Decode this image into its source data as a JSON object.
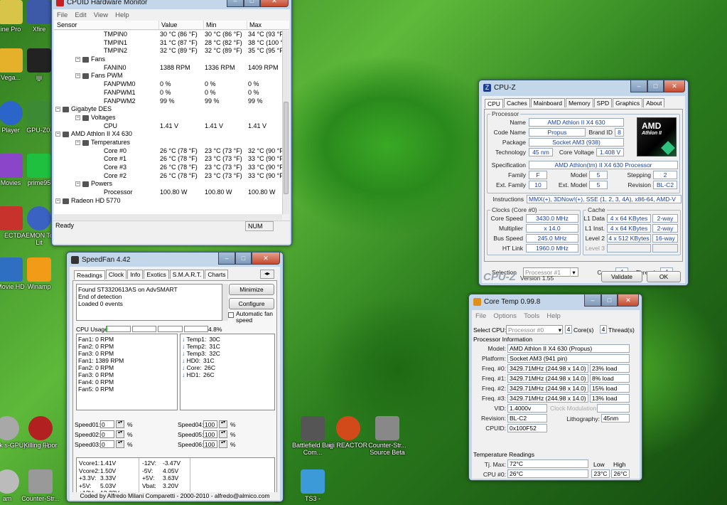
{
  "desktop": {
    "icons": [
      {
        "label": "ine Pro",
        "color": "#d9c44a"
      },
      {
        "label": "Xfire",
        "color": "#3c5aa8"
      },
      {
        "label": "Vega...",
        "color": "#e6b12a"
      },
      {
        "label": "ijji",
        "color": "#222"
      },
      {
        "label": "Player",
        "color": "#2b65c9"
      },
      {
        "label": "GPU-Z0.",
        "color": "#3d8a35"
      },
      {
        "label": "Movies",
        "color": "#8a45c8"
      },
      {
        "label": "prime95",
        "color": "#1fbf3f"
      },
      {
        "label": "ECT",
        "color": "#c8322c"
      },
      {
        "label": "DAEMON Tools Lit",
        "color": "#3a62c2"
      },
      {
        "label": "Movie HD",
        "color": "#2f6fc2"
      },
      {
        "label": "Winamp",
        "color": "#f29b16"
      },
      {
        "label": "Mark s-GPU)",
        "color": "#a8a8a8"
      },
      {
        "label": "Killing Floor",
        "color": "#b32020"
      },
      {
        "label": "H",
        "color": "#444"
      },
      {
        "label": "Battlefield Bad Com...",
        "color": "#555"
      },
      {
        "label": "ijji REACTOR",
        "color": "#d24a1a"
      },
      {
        "label": "Counter-Str... Source Beta",
        "color": "#888"
      },
      {
        "label": "am",
        "color": "#bbb"
      },
      {
        "label": "Counter-Str...",
        "color": "#999"
      },
      {
        "label": "TS3 -",
        "color": "#3c9ad8"
      },
      {
        "label": "ft",
        "color": "#777"
      }
    ]
  },
  "hwmonitor": {
    "title": "CPUID Hardware Monitor",
    "menu": [
      "File",
      "Edit",
      "View",
      "Help"
    ],
    "columns": [
      "Sensor",
      "Value",
      "Min",
      "Max"
    ],
    "rows": [
      {
        "indent": 70,
        "name": "TMPIN0",
        "v": "30 °C  (86 °F)",
        "mn": "30 °C  (86 °F)",
        "mx": "34 °C  (93 °F"
      },
      {
        "indent": 70,
        "name": "TMPIN1",
        "v": "31 °C  (87 °F)",
        "mn": "28 °C  (82 °F)",
        "mx": "38 °C  (100 °"
      },
      {
        "indent": 70,
        "name": "TMPIN2",
        "v": "32 °C  (89 °F)",
        "mn": "32 °C  (89 °F)",
        "mx": "35 °C  (95 °F"
      },
      {
        "indent": 44,
        "name": "Fans",
        "v": "",
        "mn": "",
        "mx": ""
      },
      {
        "indent": 70,
        "name": "FANIN0",
        "v": "1388 RPM",
        "mn": "1336 RPM",
        "mx": "1409 RPM"
      },
      {
        "indent": 44,
        "name": "Fans PWM",
        "v": "",
        "mn": "",
        "mx": ""
      },
      {
        "indent": 70,
        "name": "FANPWM0",
        "v": "0 %",
        "mn": "0 %",
        "mx": "0 %"
      },
      {
        "indent": 70,
        "name": "FANPWM1",
        "v": "0 %",
        "mn": "0 %",
        "mx": "0 %"
      },
      {
        "indent": 70,
        "name": "FANPWM2",
        "v": "99 %",
        "mn": "99 %",
        "mx": "99 %"
      },
      {
        "indent": 16,
        "name": "Gigabyte DES",
        "v": "",
        "mn": "",
        "mx": ""
      },
      {
        "indent": 44,
        "name": "Voltages",
        "v": "",
        "mn": "",
        "mx": ""
      },
      {
        "indent": 70,
        "name": "CPU",
        "v": "1.41 V",
        "mn": "1.41 V",
        "mx": "1.41 V"
      },
      {
        "indent": 16,
        "name": "AMD Athlon II X4 630",
        "v": "",
        "mn": "",
        "mx": ""
      },
      {
        "indent": 44,
        "name": "Temperatures",
        "v": "",
        "mn": "",
        "mx": ""
      },
      {
        "indent": 70,
        "name": "Core #0",
        "v": "26 °C  (78 °F)",
        "mn": "23 °C  (73 °F)",
        "mx": "32 °C  (90 °F"
      },
      {
        "indent": 70,
        "name": "Core #1",
        "v": "26 °C  (78 °F)",
        "mn": "23 °C  (73 °F)",
        "mx": "33 °C  (90 °F"
      },
      {
        "indent": 70,
        "name": "Core #3",
        "v": "26 °C  (78 °F)",
        "mn": "23 °C  (73 °F)",
        "mx": "33 °C  (90 °F"
      },
      {
        "indent": 70,
        "name": "Core #2",
        "v": "26 °C  (78 °F)",
        "mn": "23 °C  (73 °F)",
        "mx": "33 °C  (90 °F"
      },
      {
        "indent": 44,
        "name": "Powers",
        "v": "",
        "mn": "",
        "mx": ""
      },
      {
        "indent": 70,
        "name": "Processor",
        "v": "100.80 W",
        "mn": "100.80 W",
        "mx": "100.80 W"
      },
      {
        "indent": 16,
        "name": "Radeon HD 5770",
        "v": "",
        "mn": "",
        "mx": ""
      }
    ],
    "status": "Ready",
    "num": "NUM"
  },
  "speedfan": {
    "title": "SpeedFan 4.42",
    "tabs": [
      "Readings",
      "Clock",
      "Info",
      "Exotics",
      "S.M.A.R.T.",
      "Charts"
    ],
    "log": [
      "Found ST3320613AS on AdvSMART",
      "End of detection",
      "Loaded 0 events"
    ],
    "minimize": "Minimize",
    "configure": "Configure",
    "autofan": "Automatic fan speed",
    "cpu_usage_label": "CPU Usage",
    "cpu_usage": "4.8%",
    "fans": [
      "Fan1: 0 RPM",
      "Fan2: 0 RPM",
      "Fan3: 0 RPM",
      "Fan1: 1389 RPM",
      "Fan2: 0 RPM",
      "Fan3: 0 RPM",
      "Fan4: 0 RPM",
      "Fan5: 0 RPM"
    ],
    "temps": [
      [
        "Temp1:",
        "30C"
      ],
      [
        "Temp2:",
        "31C"
      ],
      [
        "Temp3:",
        "32C"
      ],
      [
        "HD0:",
        "31C"
      ],
      [
        "Core:",
        "26C"
      ],
      [
        "HD1:",
        "26C"
      ]
    ],
    "speeds_left": [
      [
        "Speed01:",
        "0"
      ],
      [
        "Speed02:",
        "0"
      ],
      [
        "Speed03:",
        "0"
      ]
    ],
    "speeds_right": [
      [
        "Speed04:",
        "100"
      ],
      [
        "Speed05:",
        "100"
      ],
      [
        "Speed06:",
        "100"
      ]
    ],
    "pct": "%",
    "volts": [
      [
        "Vcore1:",
        "1.41V",
        "-12V:",
        "-3.47V"
      ],
      [
        "Vcore2:",
        "1.50V",
        "-5V:",
        "4.05V"
      ],
      [
        "+3.3V:",
        "3.33V",
        "+5V:",
        "3.63V"
      ],
      [
        "+5V:",
        "5.03V",
        "Vbat:",
        "3.20V"
      ],
      [
        "+12V:",
        "12.22V",
        "",
        ""
      ]
    ],
    "footer": "Coded by Alfredo Milani Comparetti - 2000-2010 - alfredo@almico.com"
  },
  "cpuz": {
    "title": "CPU-Z",
    "tabs": [
      "CPU",
      "Caches",
      "Mainboard",
      "Memory",
      "SPD",
      "Graphics",
      "About"
    ],
    "processor": "Processor",
    "name_l": "Name",
    "name": "AMD Athlon II X4 630",
    "code_l": "Code Name",
    "code": "Propus",
    "brand_l": "Brand ID",
    "brand": "8",
    "pkg_l": "Package",
    "pkg": "Socket AM3 (938)",
    "tech_l": "Technology",
    "tech": "45 nm",
    "cv_l": "Core Voltage",
    "cv": "1.408 V",
    "spec_l": "Specification",
    "spec": "AMD Athlon(tm) II X4 630 Processor",
    "fam_l": "Family",
    "fam": "F",
    "model_l": "Model",
    "model": "5",
    "step_l": "Stepping",
    "step": "2",
    "efam_l": "Ext. Family",
    "efam": "10",
    "emod_l": "Ext. Model",
    "emod": "5",
    "rev_l": "Revision",
    "rev": "BL-C2",
    "instr_l": "Instructions",
    "instr": "MMX(+), 3DNow!(+), SSE (1, 2, 3, 4A), x86-64, AMD-V",
    "clocks": "Clocks (Core #0)",
    "cs_l": "Core Speed",
    "cs": "3430.0 MHz",
    "mul_l": "Multiplier",
    "mul": "x 14.0",
    "bus_l": "Bus Speed",
    "bus": "245.0 MHz",
    "ht_l": "HT Link",
    "ht": "1960.0 MHz",
    "cache": "Cache",
    "l1d_l": "L1 Data",
    "l1d": "4 x 64 KBytes",
    "l1d_w": "2-way",
    "l1i_l": "L1 Inst.",
    "l1i": "4 x 64 KBytes",
    "l1i_w": "2-way",
    "l2_l": "Level 2",
    "l2": "4 x 512 KBytes",
    "l2_w": "16-way",
    "l3_l": "Level 3",
    "sel_l": "Selection",
    "sel": "Processor #1",
    "cores_l": "Cores",
    "cores": "4",
    "thr_l": "Threads",
    "thr": "4",
    "brand_text": "CPU-Z",
    "version": "Version 1.55",
    "validate": "Validate",
    "ok": "OK",
    "logo_top": "AMD",
    "logo_sub": "Athlon II"
  },
  "coretemp": {
    "title": "Core Temp 0.99.8",
    "menu": [
      "File",
      "Options",
      "Tools",
      "Help"
    ],
    "sel_l": "Select CPU:",
    "sel": "Processor #0",
    "cores": "4",
    "cores_l": "Core(s)",
    "thr": "4",
    "thr_l": "Thread(s)",
    "info_h": "Processor Information",
    "model_l": "Model:",
    "model": "AMD Athlon II X4 630 (Propus)",
    "plat_l": "Platform:",
    "plat": "Socket AM3 (941 pin)",
    "freqs": [
      [
        "Freq. #0:",
        "3429.71MHz (244.98 x 14.0)",
        "23% load"
      ],
      [
        "Freq. #1:",
        "3429.71MHz (244.98 x 14.0)",
        "8% load"
      ],
      [
        "Freq. #2:",
        "3429.71MHz (244.98 x 14.0)",
        "15% load"
      ],
      [
        "Freq. #3:",
        "3429.71MHz (244.98 x 14.0)",
        "13% load"
      ]
    ],
    "vid_l": "VID:",
    "vid": "1.4000v",
    "clockmod": "Clock Modulation:",
    "rev_l": "Revision:",
    "rev": "BL-C2",
    "litho_l": "Lithography:",
    "litho": "45nm",
    "cpuid_l": "CPUID:",
    "cpuid": "0x100F52",
    "temp_h": "Temperature Readings",
    "low": "Low",
    "high": "High",
    "tjmax_l": "Tj. Max:",
    "tjmax": "72°C",
    "cpu0_l": "CPU #0:",
    "cpu0": "26°C",
    "cpu0_low": "23°C",
    "cpu0_high": "26°C"
  }
}
